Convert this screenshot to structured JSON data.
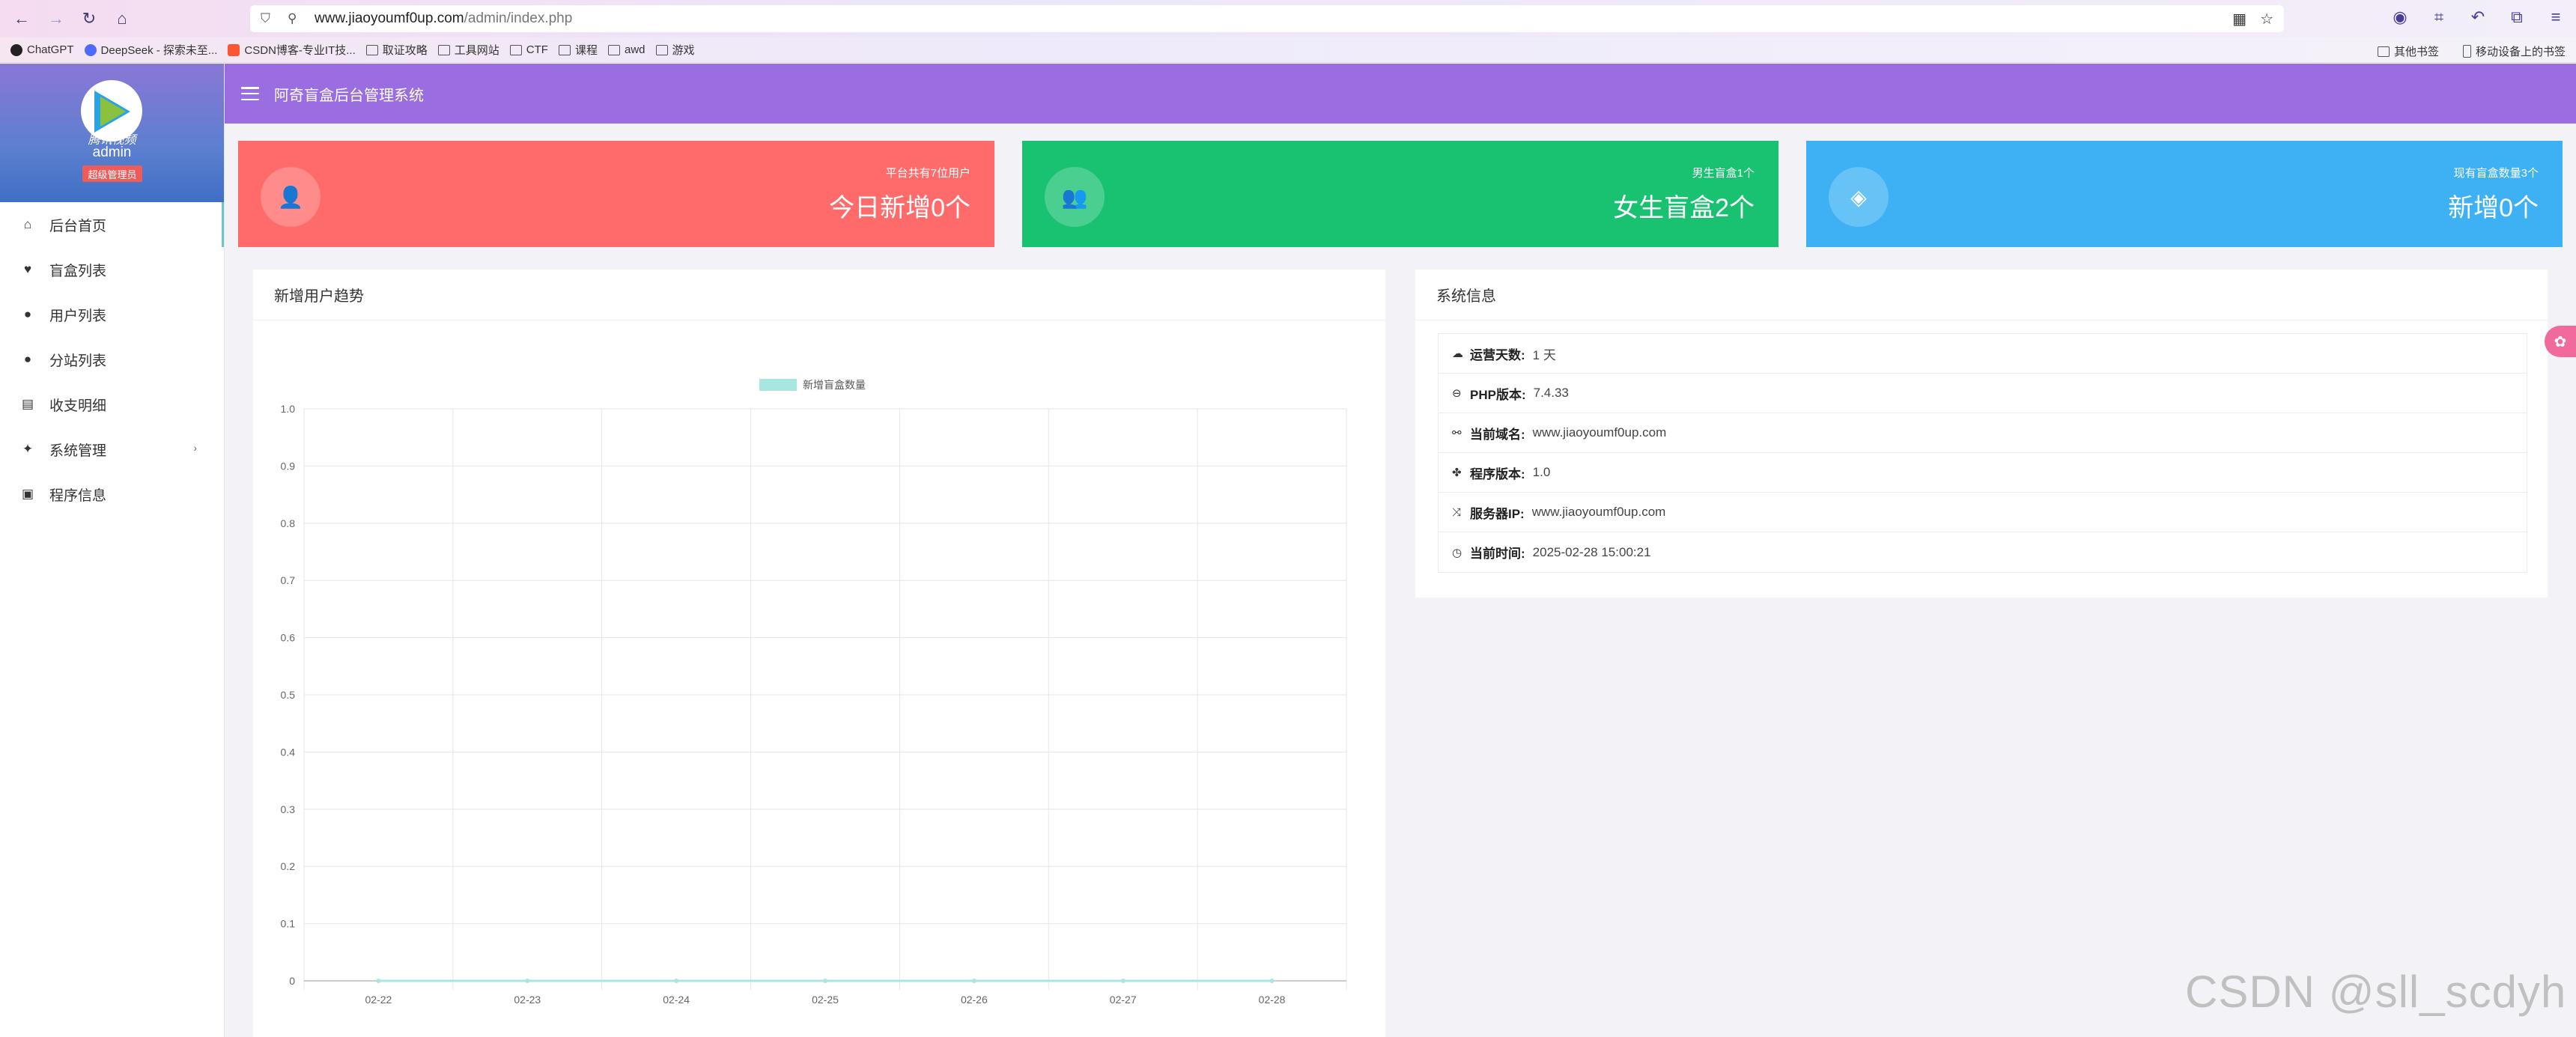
{
  "browser": {
    "url_domain": "www.jiaoyoumf0up.com",
    "url_path": "/admin/index.php",
    "bookmarks": [
      "ChatGPT",
      "DeepSeek - 探索未至...",
      "CSDN博客-专业IT技...",
      "取证攻略",
      "工具网站",
      "CTF",
      "课程",
      "awd",
      "游戏"
    ],
    "bookmarks_right": [
      "其他书签",
      "移动设备上的书签"
    ]
  },
  "sidebar": {
    "avatar_text": "腾讯视频",
    "user_name": "admin",
    "user_role": "超级管理员",
    "items": [
      {
        "label": "后台首页",
        "icon": "home-icon"
      },
      {
        "label": "盲盒列表",
        "icon": "heart-icon"
      },
      {
        "label": "用户列表",
        "icon": "user-icon"
      },
      {
        "label": "分站列表",
        "icon": "user-icon"
      },
      {
        "label": "收支明细",
        "icon": "receipt-icon"
      },
      {
        "label": "系统管理",
        "icon": "sparkle-icon"
      },
      {
        "label": "程序信息",
        "icon": "terminal-icon"
      }
    ]
  },
  "topbar": {
    "title": "阿奇盲盒后台管理系统"
  },
  "cards": [
    {
      "small": "平台共有7位用户",
      "big": "今日新增0个",
      "color": "#ff6b6b",
      "icon": "user-plus-icon"
    },
    {
      "small": "男生盲盒1个",
      "big": "女生盲盒2个",
      "color": "#18c271",
      "icon": "users-icon"
    },
    {
      "small": "现有盲盒数量3个",
      "big": "新增0个",
      "color": "#3db1f4",
      "icon": "diamond-icon"
    }
  ],
  "chart_panel": {
    "title": "新增用户趋势"
  },
  "chart_data": {
    "type": "line",
    "categories": [
      "02-22",
      "02-23",
      "02-24",
      "02-25",
      "02-26",
      "02-27",
      "02-28"
    ],
    "series": [
      {
        "name": "新增盲盒数量",
        "values": [
          0,
          0,
          0,
          0,
          0,
          0,
          0
        ],
        "color": "#a8e6e0"
      }
    ],
    "ylim": [
      0,
      1
    ],
    "yticks": [
      "0",
      "0.1",
      "0.2",
      "0.3",
      "0.4",
      "0.5",
      "0.6",
      "0.7",
      "0.8",
      "0.9",
      "1.0"
    ],
    "grid": true,
    "legend": "top-center"
  },
  "info_panel": {
    "title": "系统信息",
    "rows": [
      {
        "icon": "cloud-icon",
        "key": "运营天数:",
        "value": "1 天"
      },
      {
        "icon": "php-icon",
        "key": "PHP版本:",
        "value": "7.4.33"
      },
      {
        "icon": "link-icon",
        "key": "当前域名:",
        "value": "www.jiaoyoumf0up.com"
      },
      {
        "icon": "android-icon",
        "key": "程序版本:",
        "value": "1.0"
      },
      {
        "icon": "shuffle-icon",
        "key": "服务器IP:",
        "value": "www.jiaoyoumf0up.com"
      },
      {
        "icon": "clock-icon",
        "key": "当前时间:",
        "value": "2025-02-28 15:00:21"
      }
    ]
  },
  "watermark": "CSDN @sll_scdyh"
}
